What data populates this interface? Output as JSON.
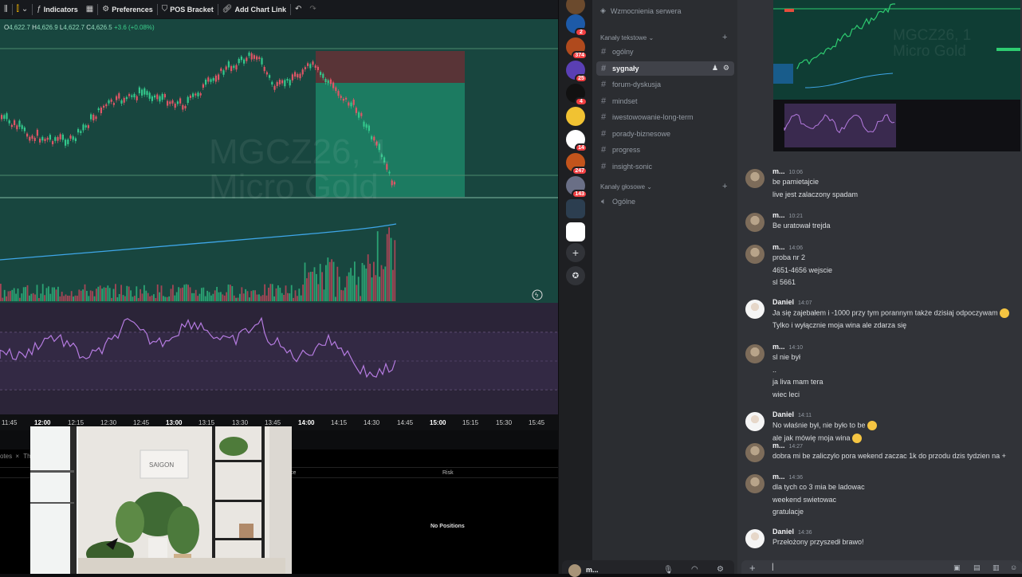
{
  "toolbar": {
    "indicators": "Indicators",
    "preferences": "Preferences",
    "pos_bracket": "POS Bracket",
    "add_chart_link": "Add Chart Link"
  },
  "ohlc": {
    "o_label": "O",
    "o": "4,622.7",
    "h_label": "H",
    "h": "4,626.9",
    "l_label": "L",
    "l": "4,622.7",
    "c_label": "C",
    "c": "4,626.5",
    "change": "+3.6 (+0.08%)"
  },
  "watermark": {
    "symbol": "MGCZ26, 1",
    "name": "Micro Gold"
  },
  "time_axis": [
    "11:45",
    "12:00",
    "12:15",
    "12:30",
    "12:45",
    "13:00",
    "13:15",
    "13:30",
    "13:45",
    "14:00",
    "14:15",
    "14:30",
    "14:45",
    "15:00",
    "15:15",
    "15:30",
    "15:45"
  ],
  "positions": {
    "tab1": "otes",
    "tab2": "Th",
    "col_risk": "Risk",
    "col_price": "ce",
    "empty": "No Positions"
  },
  "photo": {
    "sign": "SAIGON"
  },
  "discord": {
    "server_boosts": "Wzmocnienia serwera",
    "text_category": "Kanały tekstowe",
    "voice_category": "Kanały głosowe",
    "channels": [
      "ogólny",
      "sygnały",
      "forum-dyskusja",
      "mindset",
      "iwestowowanie-long-term",
      "porady-biznesowe",
      "progress",
      "insight-sonic"
    ],
    "voice_channels": [
      "Ogólne"
    ],
    "servers": [
      {
        "badge": ""
      },
      {
        "badge": "2"
      },
      {
        "badge": "374"
      },
      {
        "badge": "25"
      },
      {
        "badge": "4"
      },
      {
        "badge": ""
      },
      {
        "badge": "14"
      },
      {
        "badge": "247"
      },
      {
        "badge": "143"
      },
      {
        "badge": ""
      },
      {
        "badge": ""
      }
    ],
    "image_watermark": {
      "symbol": "MGCZ26, 1",
      "name": "Micro Gold"
    },
    "user_name": "m...",
    "messages": [
      {
        "author": "m...",
        "time": "10:06",
        "lines": [
          "be pamietajcie",
          "live jest zalaczony spadam"
        ]
      },
      {
        "author": "m...",
        "time": "10:21",
        "lines": [
          "Be uratował trejda"
        ]
      },
      {
        "author": "m...",
        "time": "14:06",
        "lines": [
          "proba nr 2",
          "4651-4656 wejscie",
          "sl 5661"
        ]
      },
      {
        "author": "Daniel",
        "time": "14:07",
        "lines": [
          "Ja się zajebałem i -1000 przy tym porannym także dzisiaj odpoczywam",
          "Tylko i wyłącznie moja wina ale zdarza się"
        ]
      },
      {
        "author": "m...",
        "time": "14:10",
        "lines": [
          "sl nie był",
          "..",
          "ja liva mam tera",
          "wiec leci"
        ]
      },
      {
        "author": "Daniel",
        "time": "14:11",
        "lines": [
          "No właśnie był, nie było to be",
          "ale jak mówię moja wina"
        ]
      },
      {
        "author": "m...",
        "time": "14:27",
        "lines": [
          "dobra  mi be zaliczylo pora wekend zaczac 1k do przodu dzis tydzien na +"
        ]
      },
      {
        "author": "m...",
        "time": "14:36",
        "lines": [
          "dla tych co 3 mia be ladowac",
          "weekend swietowac",
          "gratulacje"
        ]
      },
      {
        "author": "Daniel",
        "time": "14:36",
        "lines": [
          "Przełożony przyszedł brawo!"
        ]
      }
    ]
  }
}
